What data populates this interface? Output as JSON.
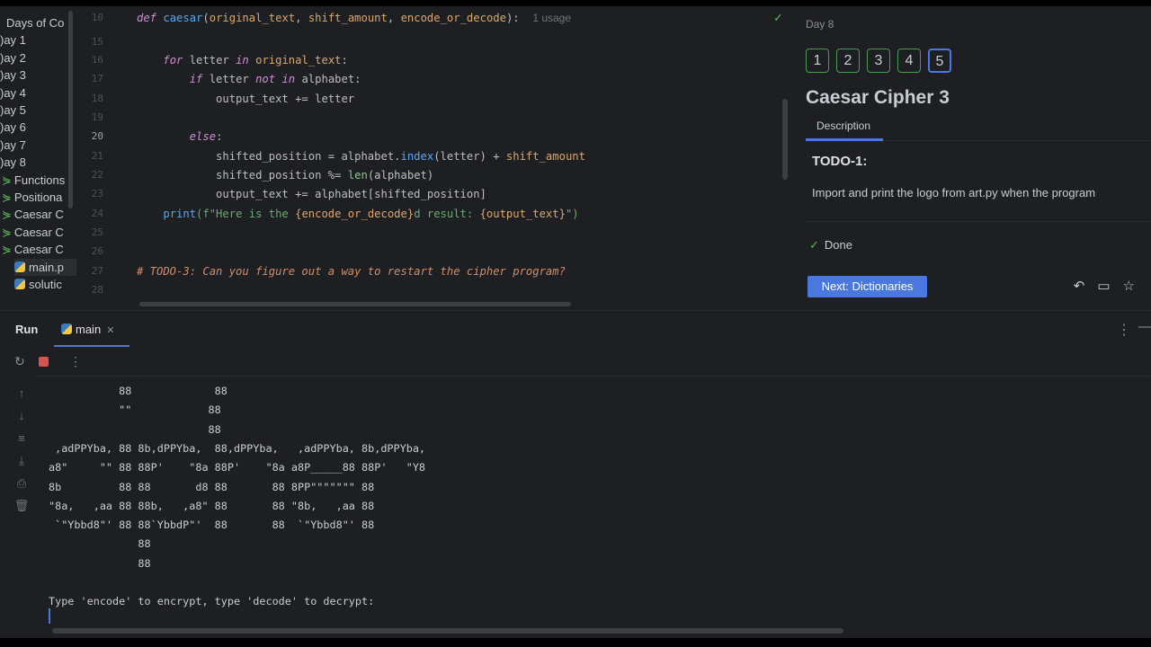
{
  "project_tree": {
    "items": [
      {
        "label": "Days of Co",
        "type": "folder"
      },
      {
        "label": ")ay 1",
        "type": "folder"
      },
      {
        "label": ")ay 2",
        "type": "folder"
      },
      {
        "label": ")ay 3",
        "type": "folder"
      },
      {
        "label": ")ay 4",
        "type": "folder"
      },
      {
        "label": ")ay 5",
        "type": "folder"
      },
      {
        "label": ")ay 6",
        "type": "folder"
      },
      {
        "label": ")ay 7",
        "type": "folder"
      },
      {
        "label": ")ay 8",
        "type": "folder"
      },
      {
        "label": "Functions",
        "type": "lesson"
      },
      {
        "label": "Positiona",
        "type": "lesson"
      },
      {
        "label": "Caesar C",
        "type": "lesson"
      },
      {
        "label": "Caesar C",
        "type": "lesson"
      },
      {
        "label": "Caesar C",
        "type": "lesson"
      },
      {
        "label": "main.p",
        "type": "python"
      },
      {
        "label": "solutic",
        "type": "python"
      }
    ]
  },
  "editor": {
    "lines": [
      {
        "num": "10",
        "tokens": [
          [
            "def ",
            "kw"
          ],
          [
            "caesar",
            "fn"
          ],
          [
            "(",
            "tx"
          ],
          [
            "original_text",
            "pa"
          ],
          [
            ", ",
            "tx"
          ],
          [
            "shift_amount",
            "pa"
          ],
          [
            ", ",
            "tx"
          ],
          [
            "encode_or_decode",
            "pa"
          ],
          [
            "):  ",
            "tx"
          ],
          [
            "1 usage",
            "hint"
          ]
        ]
      },
      {
        "num": "15",
        "tokens": []
      },
      {
        "num": "16",
        "tokens": [
          [
            "    ",
            "tx"
          ],
          [
            "for ",
            "kw"
          ],
          [
            "letter ",
            "tx"
          ],
          [
            "in ",
            "kw"
          ],
          [
            "original_text",
            "pa"
          ],
          [
            ":",
            "tx"
          ]
        ]
      },
      {
        "num": "17",
        "tokens": [
          [
            "        ",
            "tx"
          ],
          [
            "if ",
            "kw"
          ],
          [
            "letter ",
            "tx"
          ],
          [
            "not in ",
            "kw"
          ],
          [
            "alphabet:",
            "tx"
          ]
        ]
      },
      {
        "num": "18",
        "tokens": [
          [
            "            output_text += letter",
            "tx"
          ]
        ]
      },
      {
        "num": "19",
        "tokens": []
      },
      {
        "num": "20",
        "tokens": [
          [
            "        ",
            "tx"
          ],
          [
            "else",
            "kw"
          ],
          [
            ":",
            "tx"
          ]
        ]
      },
      {
        "num": "21",
        "tokens": [
          [
            "            shifted_position = alphabet.",
            "tx"
          ],
          [
            "index",
            "fn"
          ],
          [
            "(letter) + ",
            "tx"
          ],
          [
            "shift_amount",
            "pa"
          ]
        ]
      },
      {
        "num": "22",
        "tokens": [
          [
            "            shifted_position %= ",
            "tx"
          ],
          [
            "len",
            "bi"
          ],
          [
            "(alphabet)",
            "tx"
          ]
        ]
      },
      {
        "num": "23",
        "tokens": [
          [
            "            output_text += alphabet[shifted_position]",
            "tx"
          ]
        ]
      },
      {
        "num": "24",
        "tokens": [
          [
            "    ",
            "tx"
          ],
          [
            "print",
            "fn"
          ],
          [
            "(f\"Here is the ",
            "st"
          ],
          [
            "{encode_or_decode}",
            "pa"
          ],
          [
            "d result: ",
            "st"
          ],
          [
            "{output_text}",
            "pa"
          ],
          [
            "\")",
            "st"
          ]
        ]
      },
      {
        "num": "25",
        "tokens": []
      },
      {
        "num": "26",
        "tokens": []
      },
      {
        "num": "27",
        "tokens": [
          [
            "# TODO-3: Can you figure out a way to restart the cipher program?",
            "cm"
          ]
        ]
      },
      {
        "num": "28",
        "tokens": []
      }
    ]
  },
  "task_panel": {
    "breadcrumb": "Day 8",
    "steps": [
      "1",
      "2",
      "3",
      "4",
      "5"
    ],
    "current_step": 5,
    "title": "Caesar Cipher 3",
    "tab": "Description",
    "todo_heading": "TODO-1:",
    "todo_text": "Import and print the logo from art.py when the program",
    "status": "Done",
    "next_button": "Next: Dictionaries"
  },
  "run_panel": {
    "label": "Run",
    "tab": "main",
    "output_lines": [
      "           88             88",
      "           \"\"            88",
      "                         88",
      " ,adPPYba, 88 8b,dPPYba,  88,dPPYba,   ,adPPYba, 8b,dPPYba,",
      "a8\"     \"\" 88 88P'    \"8a 88P'    \"8a a8P_____88 88P'   \"Y8",
      "8b         88 88       d8 88       88 8PP\"\"\"\"\"\"\" 88",
      "\"8a,   ,aa 88 88b,   ,a8\" 88       88 \"8b,   ,aa 88",
      " `\"Ybbd8\"' 88 88`YbbdP\"'  88       88  `\"Ybbd8\"' 88",
      "              88",
      "              88",
      "",
      "Type 'encode' to encrypt, type 'decode' to decrypt:"
    ]
  },
  "colors": {
    "accent": "#4a78e0",
    "success": "#5fb760",
    "background": "#1e1f22"
  }
}
